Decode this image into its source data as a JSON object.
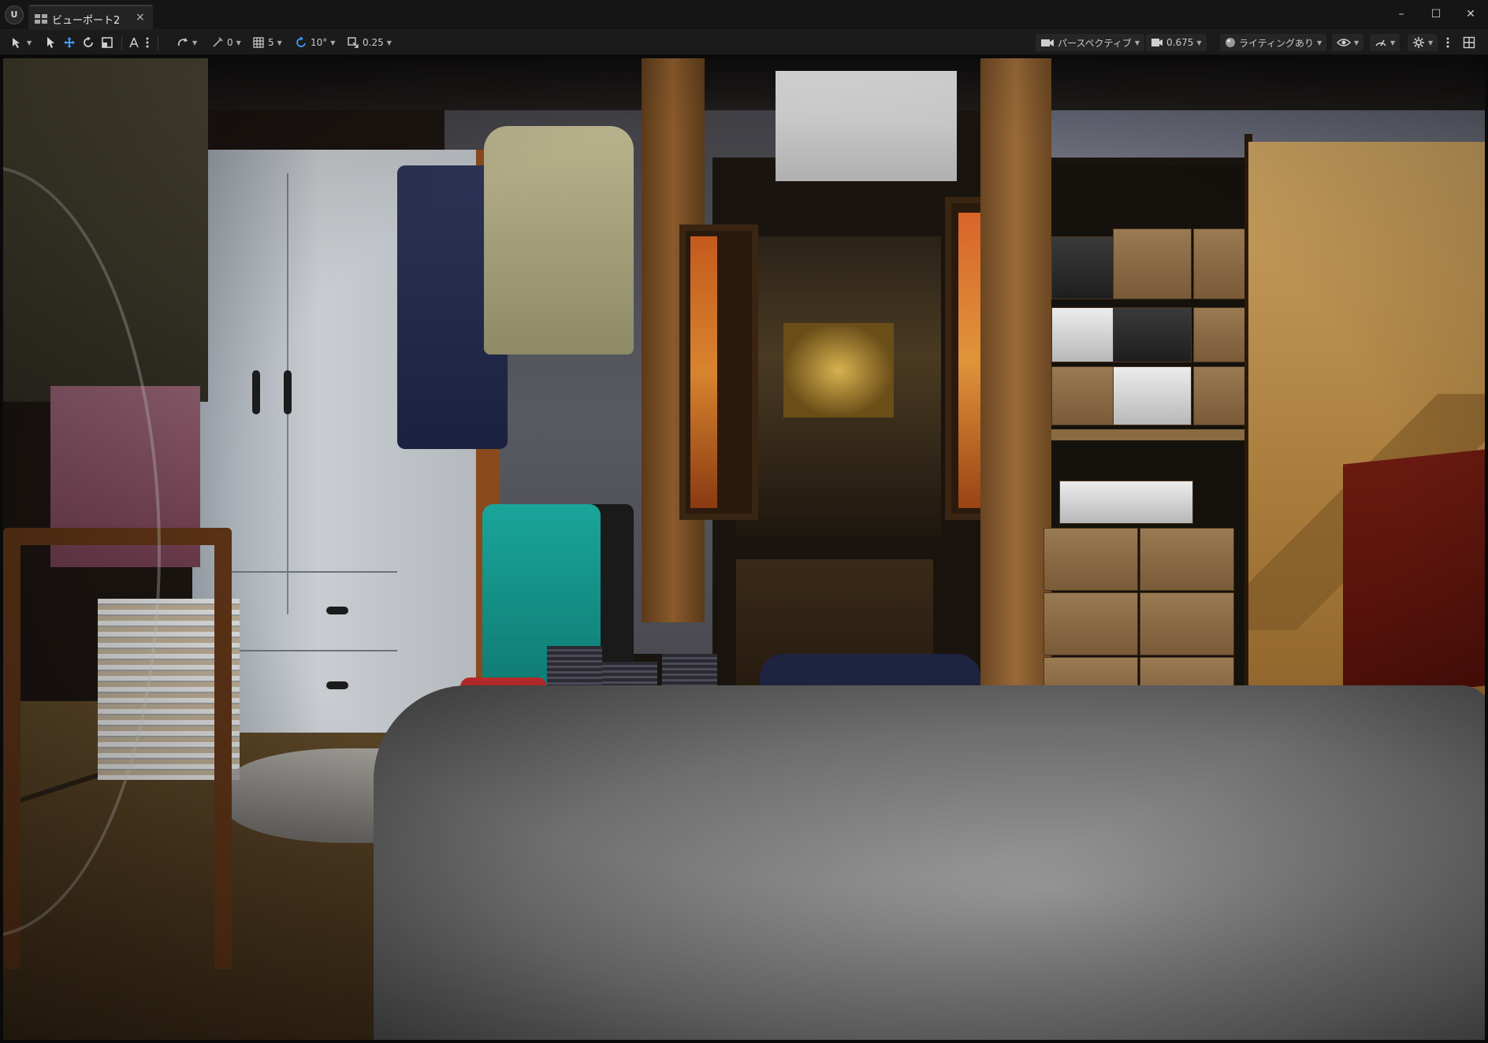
{
  "app": {
    "logo": "U"
  },
  "tab": {
    "label": "ビューポート2",
    "close": "×"
  },
  "window_controls": {
    "minimize": "–",
    "maximize": "☐",
    "close": "✕"
  },
  "toolbar": {
    "rotation_snap_value": "0",
    "grid_snap_value": "5",
    "angle_snap_value": "10°",
    "scale_snap_value": "0.25",
    "view_mode_label": "パースペクティブ",
    "camera_speed_value": "0.675",
    "lighting_label": "ライティングあり"
  },
  "icons": {
    "select_mode": "select-mode-icon",
    "select": "cursor-icon",
    "translate": "move-icon",
    "rotate": "rotate-icon",
    "scale": "scale-icon",
    "surface_snap": "surface-snap-icon",
    "more": "more-vertical-icon",
    "coordinate_space": "coordinate-space-icon",
    "rotation_snap": "rotation-snap-icon",
    "grid_snap": "grid-snap-icon",
    "angle_snap": "angle-snap-icon",
    "scale_snap": "scale-snap-icon",
    "camera": "camera-icon",
    "camera_speed": "camera-speed-icon",
    "lighting": "lighting-sphere-icon",
    "show": "eye-icon",
    "performance": "performance-icon",
    "settings": "gear-icon",
    "layout": "layout-grid-icon"
  }
}
